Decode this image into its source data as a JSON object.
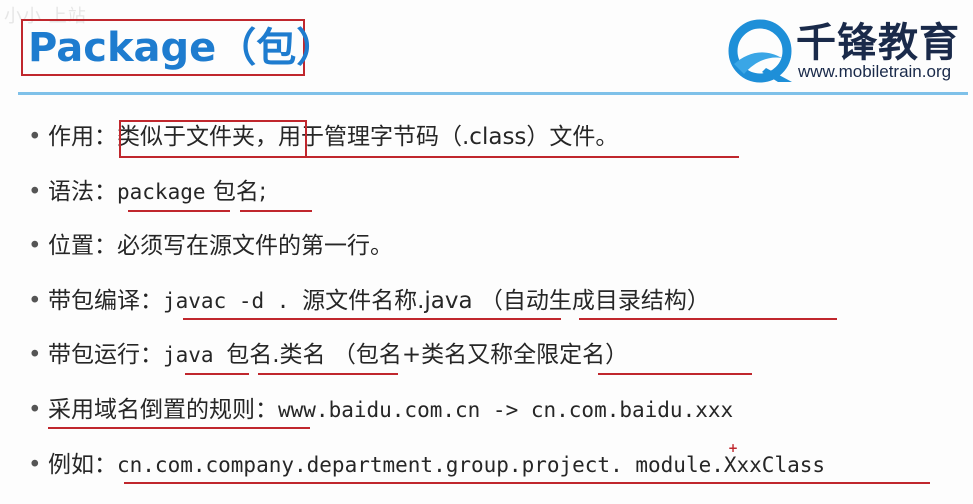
{
  "watermark": "小小 上站",
  "title": "Package（包）",
  "logo": {
    "name": "千锋教育",
    "url": "www.mobiletrain.org"
  },
  "bullets": [
    {
      "label": "作用：",
      "hl": "类似于文件夹，",
      "rest": "用于管理字节码（.class）文件。"
    },
    {
      "label": "语法：",
      "code1": "package",
      "rest": " 包名;"
    },
    {
      "label": "位置：",
      "rest": "必须写在源文件的第一行。"
    },
    {
      "label": "带包编译：",
      "code1": "javac -d . ",
      "rest": "源文件名称.java （自动生成目录结构）"
    },
    {
      "label": "带包运行：",
      "code1": "java ",
      "rest": "包名.类名 （包名+类名又称全限定名）"
    },
    {
      "label": "采用域名倒置的规则：",
      "code1": "www.baidu.com.cn  -> cn.com.baidu.xxx"
    },
    {
      "label": "例如：",
      "code1": "cn.com.company.department.group.project. module.XxxClass"
    }
  ],
  "bullet_symbol": "•",
  "plus_mark": "+"
}
